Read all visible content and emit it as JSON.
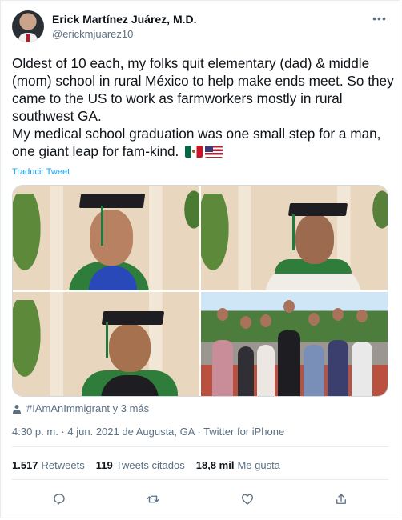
{
  "author": {
    "name": "Erick Martínez Juárez, M.D.",
    "handle": "@erickmjuarez10"
  },
  "tweet": {
    "text": "Oldest of 10 each, my folks quit elementary (dad) & middle (mom) school in rural México to help make ends meet. So they came to the US to work as farmworkers mostly in rural southwest GA.\nMy medical school graduation was one small step for a man, one giant leap for fam-kind.",
    "translate_label": "Traducir Tweet",
    "hashtags": "#IAmAnImmigrant y 3 más",
    "time": "4:30 p. m.",
    "date_place": "4 jun. 2021 de Augusta, GA",
    "separator": "·",
    "source": "Twitter for iPhone"
  },
  "stats": {
    "retweets_count": "1.517",
    "retweets_label": "Retweets",
    "quotes_count": "119",
    "quotes_label": "Tweets citados",
    "likes_count": "18,8 mil",
    "likes_label": "Me gusta"
  },
  "icons": {
    "more": "more-icon",
    "reply": "reply-icon",
    "retweet": "retweet-icon",
    "like": "heart-icon",
    "share": "share-icon"
  },
  "colors": {
    "accent": "#1da1f2",
    "muted": "#5b7083",
    "text": "#0f1419"
  }
}
